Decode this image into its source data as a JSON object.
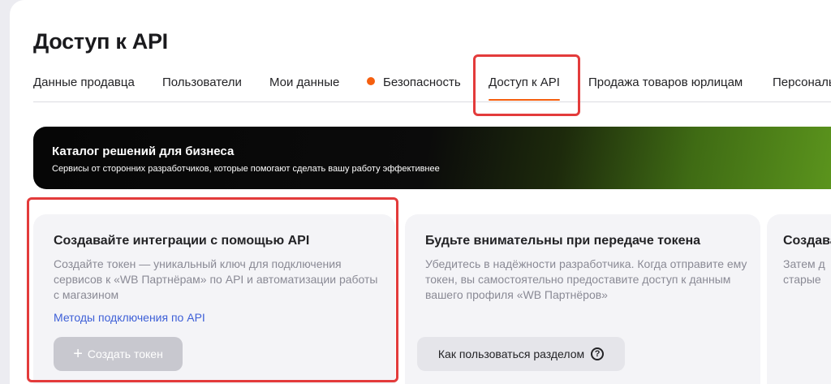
{
  "page": {
    "title": "Доступ к API"
  },
  "tabs": [
    {
      "label": "Данные продавца"
    },
    {
      "label": "Пользователи"
    },
    {
      "label": "Мои данные"
    },
    {
      "label": "Безопасность",
      "indicator": "orange-dot"
    },
    {
      "label": "Доступ к API",
      "active": true
    },
    {
      "label": "Продажа товаров юрлицам"
    },
    {
      "label": "Персональ"
    }
  ],
  "banner": {
    "title": "Каталог решений для бизнеса",
    "subtitle": "Сервисы от сторонних разработчиков, которые помогают сделать вашу работу эффективнее"
  },
  "cards": [
    {
      "title": "Создавайте интеграции с помощью API",
      "text": "Создайте токен — уникальный ключ для подключения сервисов к «WB Партнёрам» по API и автоматизации работы с магазином",
      "link": "Методы подключения по API",
      "button": "Создать токен",
      "button_state": "disabled"
    },
    {
      "title": "Будьте внимательны при передаче токена",
      "text": "Убедитесь в надёжности разработчика. Когда отправите ему токен, вы самостоятельно предоставите доступ к данным вашего профиля «WB Партнёров»",
      "button": "Как пользоваться разделом",
      "button_icon": "help-circle-icon"
    },
    {
      "title": "Создава",
      "text_line1": "Затем д",
      "text_line2": "старые"
    }
  ],
  "colors": {
    "accent": "#f55f0f",
    "highlight": "#e33b3b",
    "link": "#3d5fd7"
  }
}
